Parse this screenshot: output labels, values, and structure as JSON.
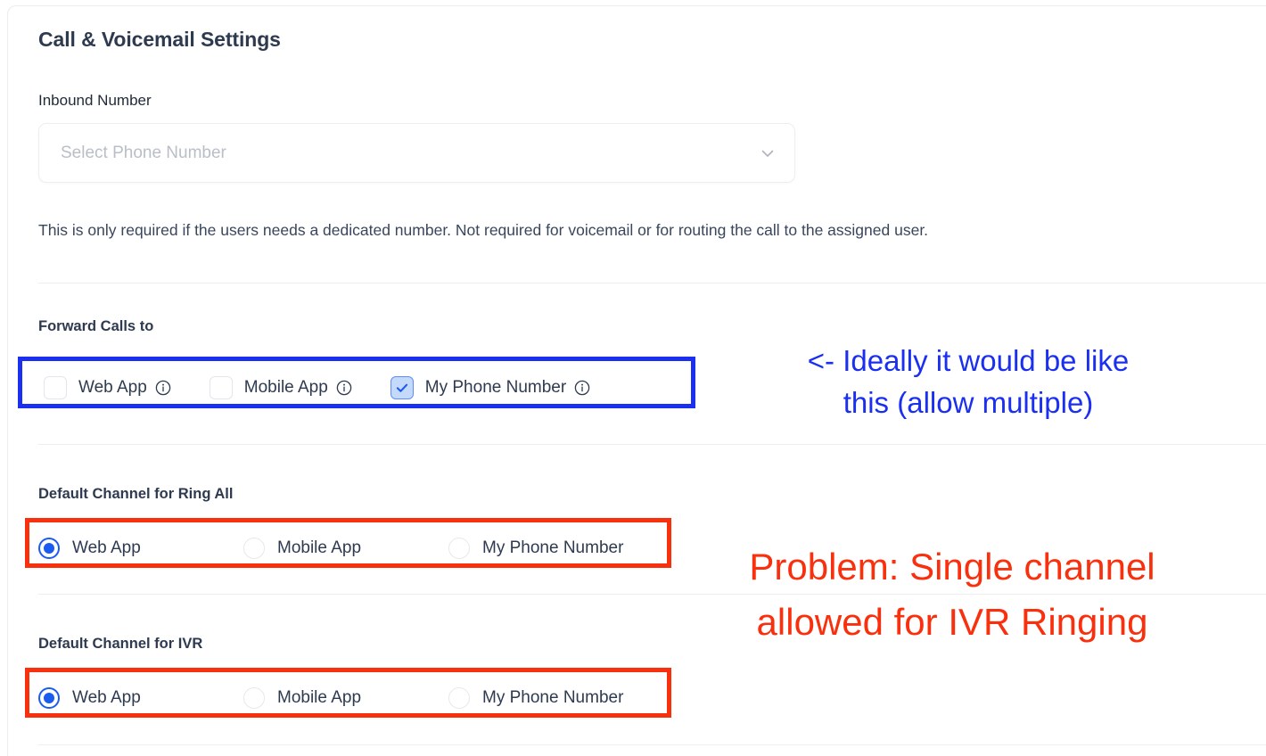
{
  "card": {
    "title": "Call & Voicemail Settings"
  },
  "inbound": {
    "label": "Inbound Number",
    "placeholder": "Select Phone Number",
    "helper": "This is only required if the users needs a dedicated number. Not required for voicemail or for routing the call to the assigned user.",
    "chevron_icon": "chevron-down-icon"
  },
  "forward_calls": {
    "label": "Forward Calls to",
    "options": [
      {
        "label": "Web App",
        "checked": false,
        "info_icon": "info-icon"
      },
      {
        "label": "Mobile App",
        "checked": false,
        "info_icon": "info-icon"
      },
      {
        "label": "My Phone Number",
        "checked": true,
        "info_icon": "info-icon"
      }
    ]
  },
  "ring_all": {
    "label": "Default Channel for Ring All",
    "options": [
      {
        "label": "Web App",
        "selected": true
      },
      {
        "label": "Mobile App",
        "selected": false
      },
      {
        "label": "My Phone Number",
        "selected": false
      }
    ]
  },
  "ivr": {
    "label": "Default Channel for IVR",
    "options": [
      {
        "label": "Web App",
        "selected": true
      },
      {
        "label": "Mobile App",
        "selected": false
      },
      {
        "label": "My Phone Number",
        "selected": false
      }
    ]
  },
  "annotations": {
    "blue_note": "<- Ideally it would be like\nthis (allow multiple)",
    "red_note": "Problem: Single channel\nallowed for IVR Ringing",
    "blue_color": "#1a2ff0",
    "red_color": "#f8300d"
  }
}
